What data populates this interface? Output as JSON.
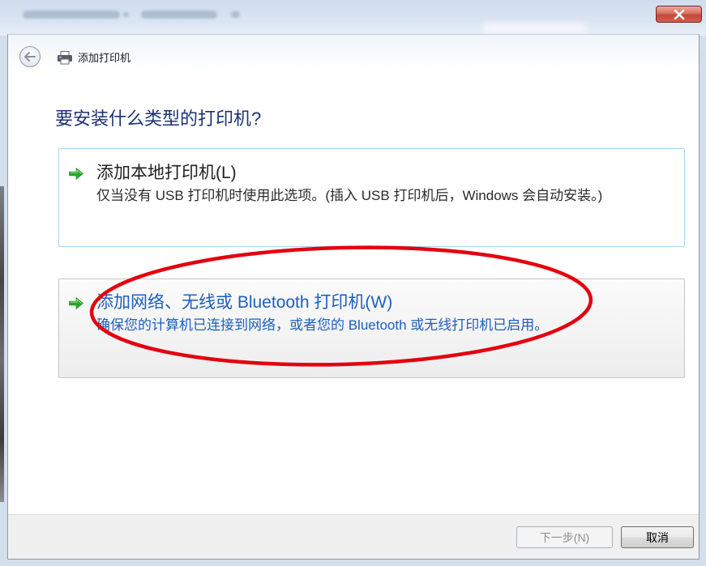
{
  "window": {
    "close_icon": "close-icon"
  },
  "nav": {
    "title": "添加打印机",
    "back_icon": "back-arrow-icon",
    "app_icon": "printer-icon"
  },
  "main": {
    "heading": "要安装什么类型的打印机?",
    "options": [
      {
        "title": "添加本地打印机(L)",
        "description": "仅当没有 USB 打印机时使用此选项。(插入 USB 打印机后，Windows 会自动安装。)",
        "icon": "green-arrow-icon",
        "highlighted": false
      },
      {
        "title": "添加网络、无线或 Bluetooth 打印机(W)",
        "description": "确保您的计算机已连接到网络，或者您的 Bluetooth 或无线打印机已启用。",
        "icon": "green-arrow-icon",
        "highlighted": true
      }
    ]
  },
  "footer": {
    "next_label": "下一步(N)",
    "next_enabled": false,
    "cancel_label": "取消"
  },
  "colors": {
    "heading": "#1c3274",
    "link-text": "#1d5fbd",
    "arrow-green": "#27a827",
    "annotation": "#e3000f",
    "close-red": "#c8453a"
  }
}
